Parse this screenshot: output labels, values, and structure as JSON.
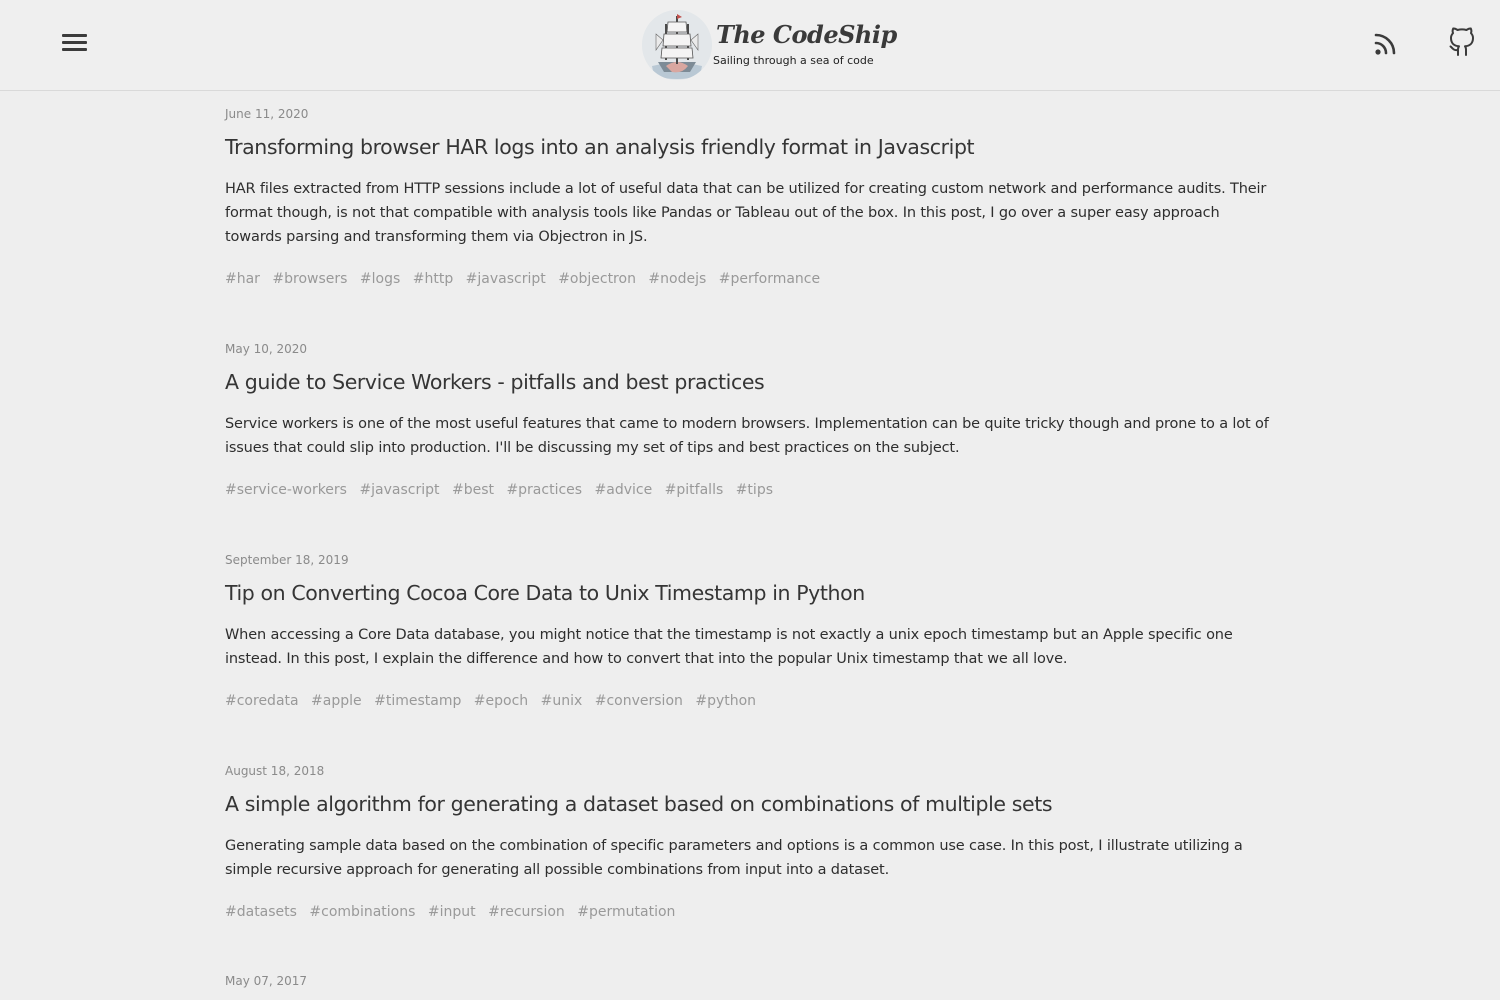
{
  "header": {
    "site_title": "The CodeShip",
    "tagline": "Sailing through a sea of code",
    "menu_icon": "hamburger-menu-icon",
    "rss_icon": "rss-icon",
    "github_icon": "github-icon"
  },
  "posts": [
    {
      "date": "June 11, 2020",
      "title": "Transforming browser HAR logs into an analysis friendly format in Javascript",
      "summary": "HAR files extracted from HTTP sessions include a lot of useful data that can be utilized for creating custom network and performance audits. Their format though, is not that compatible with analysis tools like Pandas or Tableau out of the box. In this post, I go over a super easy approach towards parsing and transforming them via Objectron in JS.",
      "tags": [
        "#har",
        "#browsers",
        "#logs",
        "#http",
        "#javascript",
        "#objectron",
        "#nodejs",
        "#performance"
      ]
    },
    {
      "date": "May 10, 2020",
      "title": "A guide to Service Workers - pitfalls and best practices",
      "summary": "Service workers is one of the most useful features that came to modern browsers. Implementation can be quite tricky though and prone to a lot of issues that could slip into production. I'll be discussing my set of tips and best practices on the subject.",
      "tags": [
        "#service-workers",
        "#javascript",
        "#best",
        "#practices",
        "#advice",
        "#pitfalls",
        "#tips"
      ]
    },
    {
      "date": "September 18, 2019",
      "title": "Tip on Converting Cocoa Core Data to Unix Timestamp in Python",
      "summary": "When accessing a Core Data database, you might notice that the timestamp is not exactly a unix epoch timestamp but an Apple specific one instead. In this post, I explain the difference and how to convert that into the popular Unix timestamp that we all love.",
      "tags": [
        "#coredata",
        "#apple",
        "#timestamp",
        "#epoch",
        "#unix",
        "#conversion",
        "#python"
      ]
    },
    {
      "date": "August 18, 2018",
      "title": "A simple algorithm for generating a dataset based on combinations of multiple sets",
      "summary": "Generating sample data based on the combination of specific parameters and options is a common use case. In this post, I illustrate utilizing a simple recursive approach for generating all possible combinations from input into a dataset.",
      "tags": [
        "#datasets",
        "#combinations",
        "#input",
        "#recursion",
        "#permutation"
      ]
    },
    {
      "date": "May 07, 2017"
    }
  ]
}
